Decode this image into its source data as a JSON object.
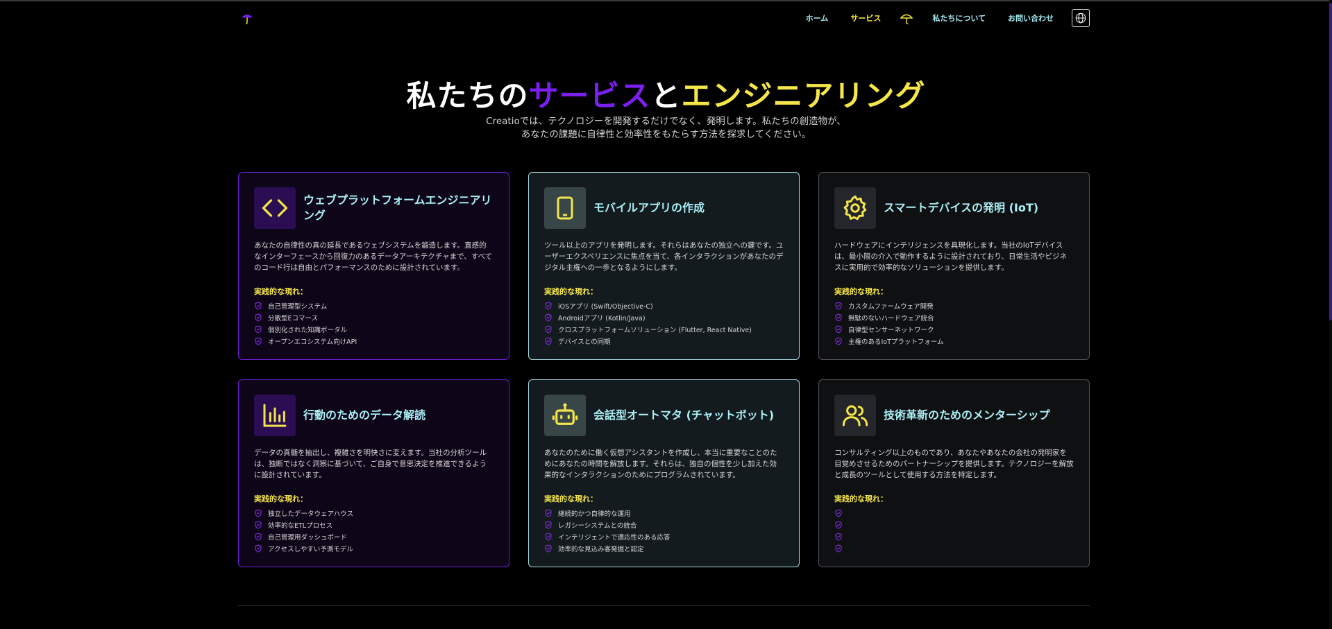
{
  "nav": {
    "links": [
      {
        "label": "ホーム",
        "active": false
      },
      {
        "label": "サービス",
        "active": true
      },
      {
        "label": "私たちについて",
        "active": false
      },
      {
        "label": "お問い合わせ",
        "active": false
      }
    ],
    "icons": {
      "logo": "umbrella-logo-icon",
      "umbrella": "umbrella-icon",
      "language": "globe-icon"
    }
  },
  "hero": {
    "title_part1": "私たちの",
    "title_part2": "サービス",
    "title_part3": "と",
    "title_part4": "エンジニアリング",
    "subtitle_line1": "Creatioでは、テクノロジーを開発するだけでなく、発明します。私たちの創造物が、",
    "subtitle_line2": "あなたの課題に自律性と効率性をもたらす方法を探求してください。"
  },
  "colors": {
    "purple": "#7b1ff0",
    "yellow": "#f5e64a",
    "cyan": "#aaf0f7"
  },
  "cards": [
    {
      "icon": "code-icon",
      "title": "ウェブプラットフォームエンジニアリング",
      "description": "あなたの自律性の真の延長であるウェブシステムを鍛造します。直感的なインターフェースから回復力のあるデータアーキテクチャまで、すべてのコード行は自由とパフォーマンスのために設計されています。",
      "practical_label": "実践的な現れ：",
      "items": [
        "自己管理型システム",
        "分散型Eコマース",
        "個別化された知識ポータル",
        "オープンエコシステム向けAPI"
      ]
    },
    {
      "icon": "tablet-icon",
      "title": "モバイルアプリの作成",
      "description": "ツール以上のアプリを発明します。それらはあなたの独立への鍵です。ユーザーエクスペリエンスに焦点を当て、各インタラクションがあなたのデジタル主権への一歩となるようにします。",
      "practical_label": "実践的な現れ：",
      "items": [
        "iOSアプリ (Swift/Objective-C)",
        "Androidアプリ (Kotlin/Java)",
        "クロスプラットフォームソリューション (Flutter, React Native)",
        "デバイスとの同期"
      ]
    },
    {
      "icon": "gear-icon",
      "title": "スマートデバイスの発明 (IoT)",
      "description": "ハードウェアにインテリジェンスを具現化します。当社のIoTデバイスは、最小限の介入で動作するように設計されており、日常生活やビジネスに実用的で効率的なソリューションを提供します。",
      "practical_label": "実践的な現れ：",
      "items": [
        "カスタムファームウェア開発",
        "無駄のないハードウェア統合",
        "自律型センサーネットワーク",
        "主権のあるIoTプラットフォーム"
      ]
    },
    {
      "icon": "bar-chart-icon",
      "title": "行動のためのデータ解読",
      "description": "データの真髄を抽出し、複雑さを明快さに変えます。当社の分析ツールは、独断ではなく洞察に基づいて、ご自身で意思決定を推進できるように設計されています。",
      "practical_label": "実践的な現れ：",
      "items": [
        "独立したデータウェアハウス",
        "効率的なETLプロセス",
        "自己管理用ダッシュボード",
        "アクセスしやすい予測モデル"
      ]
    },
    {
      "icon": "robot-icon",
      "title": "会話型オートマタ (チャットボット)",
      "description": "あなたのために働く仮想アシスタントを作成し、本当に重要なことのためにあなたの時間を解放します。それらは、独自の個性を少し加えた効果的なインタラクションのためにプログラムされています。",
      "practical_label": "実践的な現れ：",
      "items": [
        "継続的かつ自律的な運用",
        "レガシーシステムとの統合",
        "インテリジェントで適応性のある応答",
        "効率的な見込み客発掘と認定"
      ]
    },
    {
      "icon": "users-icon",
      "title": "技術革新のためのメンターシップ",
      "description": "コンサルティング以上のものであり、あなたやあなたの会社の発明家を目覚めさせるためのパートナーシップを提供します。テクノロジーを解放と成長のツールとして使用する方法を特定します。",
      "practical_label": "実践的な現れ：",
      "items": [
        "",
        "",
        "",
        ""
      ]
    }
  ]
}
